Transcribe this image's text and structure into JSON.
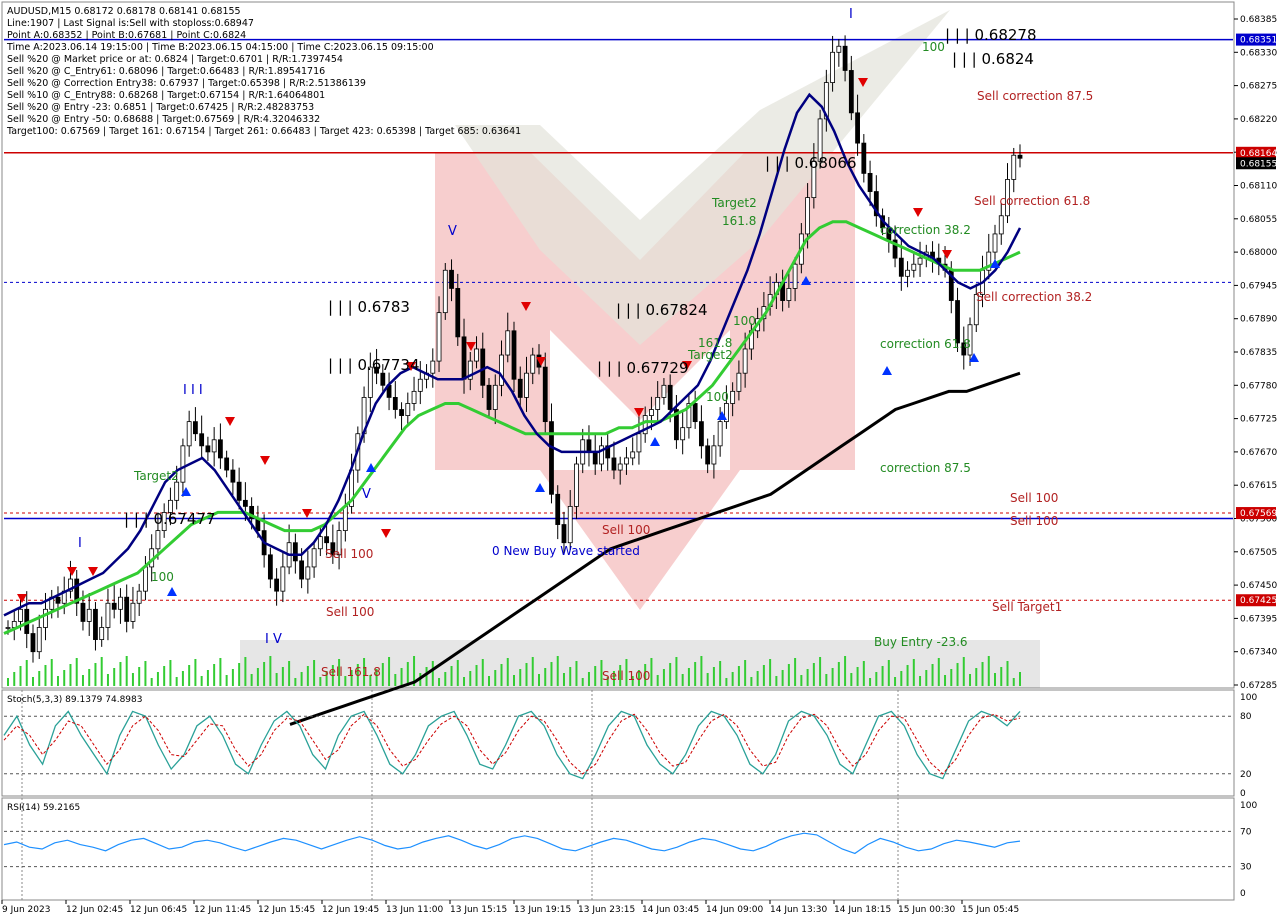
{
  "window": {
    "symbol_line": "AUDUSD,M15  0.68172 0.68178 0.68141 0.68155"
  },
  "info_lines": [
    "Line:1907 | Last Signal is:Sell with stoploss:0.68947",
    "Point A:0.68352 | Point B:0.67681 | Point C:0.6824",
    "Time A:2023.06.14 19:15:00 | Time B:2023.06.15 04:15:00 | Time C:2023.06.15 09:15:00",
    "Sell %20 @ Market price or at: 0.6824 | Target:0.6701 | R/R:1.7397454",
    "Sell %20 @ C_Entry61: 0.68096 | Target:0.66483 | R/R:1.89541716",
    "Sell %20 @ Correction Entry38: 0.67937 | Target:0.65398 | R/R:2.51386139",
    "Sell %10 @ C_Entry88: 0.68268 | Target:0.67154 | R/R:1.64064801",
    "Sell %20 @ Entry -23: 0.6851 | Target:0.67425 | R/R:2.48283753",
    "Sell %20 @ Entry -50: 0.68688 | Target:0.67569 | R/R:4.32046332",
    "Target100: 0.67569 | Target 161: 0.67154 | Target 261: 0.66483 | Target 423: 0.65398 | Target 685: 0.63641"
  ],
  "chart_data": {
    "type": "line",
    "title": "AUDUSD,M15",
    "y_axis_ticks": [
      "0.68385",
      "0.68330",
      "0.68275",
      "0.68220",
      "0.68165",
      "0.68110",
      "0.68055",
      "0.68000",
      "0.67945",
      "0.67890",
      "0.67835",
      "0.67780",
      "0.67725",
      "0.67670",
      "0.67615",
      "0.67560",
      "0.67505",
      "0.67450",
      "0.67395",
      "0.67340",
      "0.67285"
    ],
    "ylim": [
      0.67285,
      0.68385
    ],
    "x_axis_ticks": [
      "9 Jun 2023",
      "12 Jun 02:45",
      "12 Jun 06:45",
      "12 Jun 11:45",
      "12 Jun 15:45",
      "12 Jun 19:45",
      "13 Jun 11:00",
      "13 Jun 15:15",
      "13 Jun 19:15",
      "13 Jun 23:15",
      "14 Jun 03:45",
      "14 Jun 09:00",
      "14 Jun 13:30",
      "14 Jun 18:15",
      "15 Jun 00:30",
      "15 Jun 05:45"
    ],
    "price_tags": [
      {
        "value": "0.68351",
        "color": "#0000cc"
      },
      {
        "value": "0.68164",
        "color": "#cc0000"
      },
      {
        "value": "0.68155",
        "color": "#000000"
      },
      {
        "value": "0.67569",
        "color": "#cc0000"
      },
      {
        "value": "0.67425",
        "color": "#cc0000"
      }
    ],
    "close_series": [
      0.6738,
      0.6739,
      0.6741,
      0.6737,
      0.6734,
      0.6738,
      0.6741,
      0.6743,
      0.6742,
      0.6744,
      0.6746,
      0.6742,
      0.6739,
      0.6741,
      0.6736,
      0.6738,
      0.6742,
      0.6741,
      0.6743,
      0.6739,
      0.6742,
      0.6744,
      0.6748,
      0.6751,
      0.6754,
      0.6757,
      0.6759,
      0.6762,
      0.6768,
      0.6772,
      0.677,
      0.6768,
      0.6767,
      0.6769,
      0.6766,
      0.6764,
      0.6762,
      0.6759,
      0.6758,
      0.6756,
      0.6754,
      0.675,
      0.6746,
      0.6744,
      0.6748,
      0.6752,
      0.6749,
      0.6746,
      0.6748,
      0.6751,
      0.6753,
      0.6752,
      0.675,
      0.6754,
      0.6758,
      0.6764,
      0.677,
      0.6776,
      0.6781,
      0.678,
      0.6778,
      0.6776,
      0.6774,
      0.6773,
      0.6775,
      0.6777,
      0.6779,
      0.678,
      0.6782,
      0.679,
      0.6797,
      0.6794,
      0.6786,
      0.6779,
      0.6782,
      0.6784,
      0.6778,
      0.6774,
      0.6778,
      0.6783,
      0.6787,
      0.6779,
      0.6776,
      0.678,
      0.6783,
      0.6781,
      0.6772,
      0.676,
      0.6755,
      0.6752,
      0.6758,
      0.6765,
      0.6769,
      0.6767,
      0.6765,
      0.6768,
      0.6766,
      0.6764,
      0.6765,
      0.6766,
      0.6767,
      0.677,
      0.6773,
      0.6774,
      0.6776,
      0.6778,
      0.6774,
      0.6769,
      0.6771,
      0.6775,
      0.6772,
      0.6768,
      0.6765,
      0.6768,
      0.6772,
      0.6775,
      0.6777,
      0.678,
      0.6784,
      0.6787,
      0.6789,
      0.6791,
      0.6793,
      0.6795,
      0.6792,
      0.6794,
      0.6798,
      0.6803,
      0.6809,
      0.6815,
      0.6822,
      0.6828,
      0.6833,
      0.6834,
      0.683,
      0.6823,
      0.6818,
      0.6813,
      0.681,
      0.6806,
      0.6804,
      0.6802,
      0.6799,
      0.6796,
      0.6797,
      0.6798,
      0.6799,
      0.68,
      0.6799,
      0.6798,
      0.6797,
      0.6792,
      0.6785,
      0.6783,
      0.6788,
      0.6793,
      0.6797,
      0.68,
      0.6803,
      0.6806,
      0.6812,
      0.6816,
      0.68155
    ],
    "ma_blue": [
      0.674,
      0.6741,
      0.6742,
      0.6742,
      0.6743,
      0.6744,
      0.6745,
      0.6746,
      0.6747,
      0.6749,
      0.6751,
      0.6754,
      0.6758,
      0.6762,
      0.6764,
      0.6765,
      0.6766,
      0.6764,
      0.6761,
      0.6758,
      0.6755,
      0.6752,
      0.6751,
      0.675,
      0.675,
      0.6752,
      0.6755,
      0.6759,
      0.6764,
      0.677,
      0.6775,
      0.6778,
      0.678,
      0.6781,
      0.678,
      0.6779,
      0.6779,
      0.6779,
      0.678,
      0.6781,
      0.678,
      0.6777,
      0.6773,
      0.677,
      0.6768,
      0.6767,
      0.6767,
      0.6767,
      0.6767,
      0.6768,
      0.6769,
      0.677,
      0.6771,
      0.6772,
      0.6774,
      0.6776,
      0.6778,
      0.6782,
      0.6787,
      0.6792,
      0.6797,
      0.6803,
      0.681,
      0.6817,
      0.6823,
      0.6826,
      0.6824,
      0.682,
      0.6815,
      0.6811,
      0.6808,
      0.6805,
      0.6803,
      0.6801,
      0.68,
      0.6799,
      0.6797,
      0.6795,
      0.6794,
      0.6795,
      0.6797,
      0.68,
      0.6804
    ],
    "ma_green": [
      0.6737,
      0.6738,
      0.6739,
      0.674,
      0.6741,
      0.6742,
      0.6743,
      0.6744,
      0.6745,
      0.6746,
      0.6747,
      0.6749,
      0.6751,
      0.6753,
      0.6755,
      0.6756,
      0.6757,
      0.6757,
      0.6757,
      0.6756,
      0.6755,
      0.6754,
      0.6754,
      0.6754,
      0.6755,
      0.6757,
      0.6759,
      0.6762,
      0.6765,
      0.6768,
      0.6771,
      0.6773,
      0.6774,
      0.6775,
      0.6775,
      0.6774,
      0.6773,
      0.6772,
      0.6771,
      0.677,
      0.677,
      0.677,
      0.677,
      0.677,
      0.677,
      0.677,
      0.6771,
      0.6771,
      0.6772,
      0.6772,
      0.6773,
      0.6774,
      0.6776,
      0.6778,
      0.6781,
      0.6784,
      0.6787,
      0.679,
      0.6794,
      0.6798,
      0.6802,
      0.6804,
      0.6805,
      0.6805,
      0.6804,
      0.6803,
      0.6802,
      0.6801,
      0.68,
      0.6799,
      0.6798,
      0.6797,
      0.6797,
      0.6797,
      0.6798,
      0.6799,
      0.68
    ],
    "ma_black": [
      0.6722,
      0.6723,
      0.6724,
      0.6725,
      0.6726,
      0.6727,
      0.6728,
      0.6729,
      0.6731,
      0.6733,
      0.6735,
      0.6737,
      0.6739,
      0.6741,
      0.6743,
      0.6745,
      0.6747,
      0.6749,
      0.6751,
      0.6752,
      0.6753,
      0.6754,
      0.6755,
      0.6756,
      0.6757,
      0.6758,
      0.6759,
      0.676,
      0.6762,
      0.6764,
      0.6766,
      0.6768,
      0.677,
      0.6772,
      0.6774,
      0.6775,
      0.6776,
      0.6777,
      0.6777,
      0.6778,
      0.6779,
      0.678
    ],
    "horizontal_levels": [
      {
        "value": 0.68351,
        "color": "#0000cc",
        "style": "solid"
      },
      {
        "value": 0.68164,
        "color": "#cc0000",
        "style": "solid"
      },
      {
        "value": 0.6795,
        "color": "#0000cc",
        "style": "dashed"
      },
      {
        "value": 0.67569,
        "color": "#cc0000",
        "style": "dashed"
      },
      {
        "value": 0.6756,
        "color": "#0000cc",
        "style": "solid"
      },
      {
        "value": 0.67425,
        "color": "#cc0000",
        "style": "dashed"
      }
    ],
    "level_labels": [
      "| | | 0.68278",
      "| | | 0.6824",
      "| | | 0.68066",
      "| | | 0.6783",
      "| | | 0.67824",
      "| | | 0.67734",
      "| | | 0.67729",
      "| | | 0.67477"
    ],
    "annotations": [
      {
        "text": "Sell correction 87.5",
        "color": "#b22222"
      },
      {
        "text": "Sell correction 61.8",
        "color": "#b22222"
      },
      {
        "text": "Sell correction 38.2",
        "color": "#b22222"
      },
      {
        "text": "correction 38.2",
        "color": "#228b22"
      },
      {
        "text": "correction 61.8",
        "color": "#228b22"
      },
      {
        "text": "correction 87.5",
        "color": "#228b22"
      },
      {
        "text": "Sell 100",
        "color": "#b22222"
      },
      {
        "text": "Sell 100",
        "color": "#b22222"
      },
      {
        "text": "Sell Target1",
        "color": "#b22222"
      },
      {
        "text": "Buy Entry -23.6",
        "color": "#228b22"
      },
      {
        "text": "Target2",
        "color": "#228b22"
      },
      {
        "text": "161.8",
        "color": "#228b22"
      },
      {
        "text": "Target2",
        "color": "#228b22"
      },
      {
        "text": "100",
        "color": "#228b22"
      },
      {
        "text": "161.8",
        "color": "#228b22"
      },
      {
        "text": "100",
        "color": "#228b22"
      },
      {
        "text": "100",
        "color": "#228b22"
      },
      {
        "text": "Target2",
        "color": "#228b22"
      },
      {
        "text": "100",
        "color": "#228b22"
      },
      {
        "text": "Sell 100",
        "color": "#b22222"
      },
      {
        "text": "Sell 100",
        "color": "#b22222"
      },
      {
        "text": "Sell 161.8",
        "color": "#b22222"
      },
      {
        "text": "Sell 100",
        "color": "#b22222"
      },
      {
        "text": "Sell 100",
        "color": "#b22222"
      },
      {
        "text": "0 New Buy Wave started",
        "color": "#0000cc"
      }
    ],
    "wave_labels": [
      "I",
      "I I I",
      "I V",
      "V",
      "V",
      "I"
    ]
  },
  "stoch": {
    "label": "Stoch(5,3,3) 89.1379 74.8983",
    "levels": [
      "100",
      "80",
      "20",
      "0"
    ],
    "main": [
      60,
      80,
      50,
      30,
      70,
      85,
      60,
      40,
      20,
      60,
      85,
      80,
      50,
      25,
      40,
      70,
      80,
      60,
      30,
      20,
      50,
      75,
      85,
      70,
      40,
      25,
      60,
      80,
      85,
      60,
      30,
      20,
      40,
      70,
      80,
      85,
      60,
      30,
      25,
      50,
      80,
      85,
      70,
      40,
      20,
      15,
      40,
      70,
      85,
      80,
      50,
      30,
      20,
      40,
      70,
      85,
      80,
      60,
      30,
      20,
      40,
      75,
      85,
      80,
      60,
      30,
      20,
      50,
      80,
      85,
      70,
      40,
      20,
      15,
      45,
      75,
      85,
      80,
      70,
      85
    ],
    "signal": [
      55,
      70,
      60,
      40,
      55,
      75,
      70,
      50,
      30,
      45,
      70,
      80,
      65,
      40,
      38,
      55,
      72,
      70,
      45,
      28,
      40,
      65,
      78,
      75,
      55,
      35,
      45,
      70,
      82,
      70,
      45,
      28,
      35,
      55,
      72,
      80,
      70,
      45,
      30,
      42,
      65,
      80,
      75,
      55,
      32,
      20,
      30,
      55,
      75,
      82,
      65,
      42,
      28,
      32,
      55,
      75,
      82,
      70,
      45,
      28,
      32,
      60,
      78,
      82,
      70,
      45,
      28,
      40,
      65,
      80,
      78,
      55,
      32,
      20,
      35,
      60,
      78,
      82,
      75,
      78
    ]
  },
  "rsi": {
    "label": "RSI(14) 59.2165",
    "levels": [
      "100",
      "70",
      "30",
      "0"
    ],
    "values": [
      55,
      58,
      52,
      50,
      57,
      60,
      55,
      52,
      48,
      55,
      60,
      62,
      56,
      50,
      52,
      58,
      60,
      57,
      52,
      48,
      53,
      58,
      62,
      60,
      55,
      50,
      55,
      60,
      64,
      60,
      54,
      50,
      52,
      58,
      62,
      65,
      60,
      54,
      50,
      55,
      62,
      65,
      62,
      56,
      50,
      48,
      53,
      58,
      62,
      60,
      55,
      50,
      48,
      52,
      58,
      62,
      60,
      55,
      50,
      48,
      53,
      60,
      65,
      68,
      66,
      58,
      50,
      45,
      55,
      62,
      58,
      52,
      48,
      50,
      56,
      60,
      58,
      55,
      52,
      57,
      59
    ]
  }
}
